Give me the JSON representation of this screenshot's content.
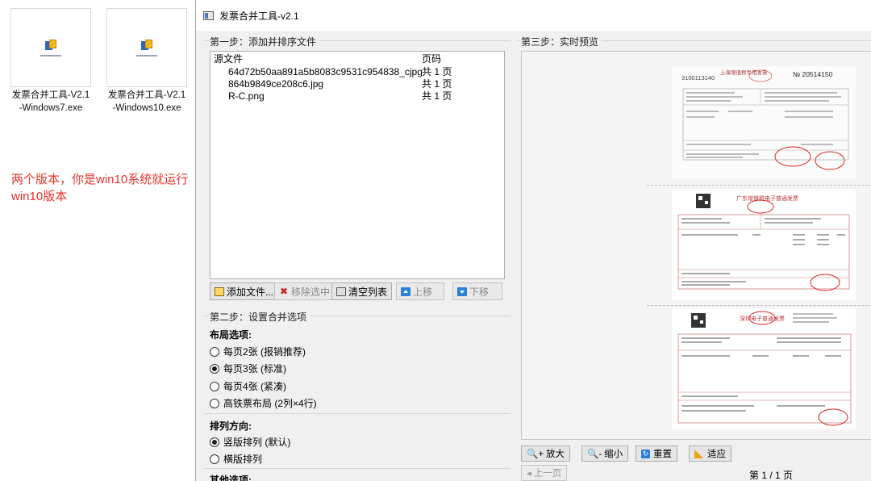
{
  "desktop": {
    "icons": [
      {
        "label": "发票合并工具-V2.1-Windows7.exe",
        "icon": "app-exe-icon"
      },
      {
        "label": "发票合并工具-V2.1-Windows10.exe",
        "icon": "app-exe-icon"
      }
    ],
    "note": "两个版本，你是win10系统就运行win10版本",
    "note_color": "#e8332d"
  },
  "window": {
    "title": "发票合并工具-v2.1",
    "step1": {
      "title": "第一步：添加并排序文件",
      "columns": [
        "源文件",
        "页码"
      ],
      "files": [
        {
          "name": "64d72b50aa891a5b8083c9531c954838_cjpg",
          "pages": "共 1 页"
        },
        {
          "name": "864b9849ce208c6.jpg",
          "pages": "共 1 页"
        },
        {
          "name": "R-C.png",
          "pages": "共 1 页"
        }
      ],
      "buttons": {
        "add": "添加文件...",
        "remove": "移除选中",
        "clear": "清空列表",
        "up": "上移",
        "down": "下移"
      }
    },
    "step2": {
      "title": "第二步：设置合并选项",
      "layout_label": "布局选项:",
      "layout_options": [
        {
          "label": "每页2张 (报销推荐)",
          "checked": false
        },
        {
          "label": "每页3张 (标准)",
          "checked": true
        },
        {
          "label": "每页4张 (紧凑)",
          "checked": false
        },
        {
          "label": "高铁票布局 (2列×4行)",
          "checked": false
        }
      ],
      "direction_label": "排列方向:",
      "direction_options": [
        {
          "label": "竖版排列 (默认)",
          "checked": true
        },
        {
          "label": "横版排列",
          "checked": false
        }
      ],
      "other_label": "其他选项:"
    },
    "step3": {
      "title": "第三步：实时预览",
      "invoices": [
        {
          "heading": "上海增值税专用发票",
          "number": "№ 20514150",
          "code": "3100113140"
        },
        {
          "heading": "广东增值税电子普通发票"
        },
        {
          "heading": "深圳电子普通发票"
        }
      ],
      "controls": {
        "zoom_in": "放大",
        "zoom_out": "缩小",
        "reset": "重置",
        "fit": "适应",
        "prev": "上一页",
        "page": "第 1 / 1 页"
      }
    }
  }
}
